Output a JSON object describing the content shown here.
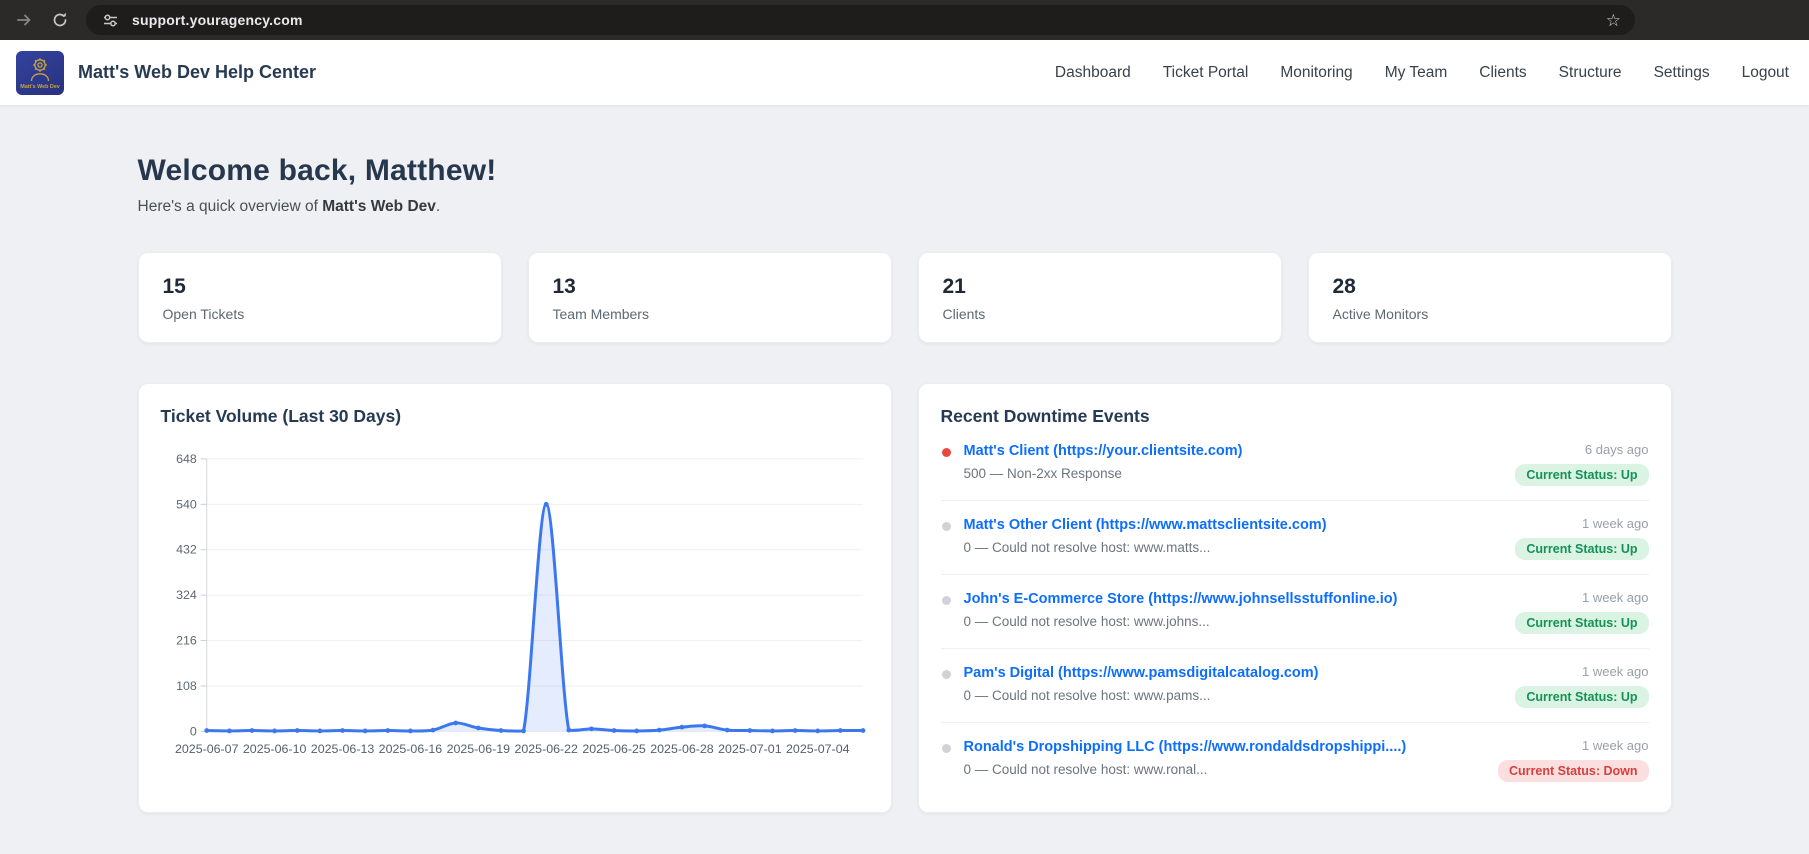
{
  "browser": {
    "url": "support.youragency.com"
  },
  "header": {
    "title": "Matt's Web Dev Help Center",
    "logo_text": "Matt's Web Dev",
    "nav": [
      "Dashboard",
      "Ticket Portal",
      "Monitoring",
      "My Team",
      "Clients",
      "Structure",
      "Settings",
      "Logout"
    ]
  },
  "welcome": {
    "heading": "Welcome back, Matthew!",
    "subtitle_prefix": "Here's a quick overview of ",
    "brand": "Matt's Web Dev",
    "subtitle_suffix": "."
  },
  "stats": [
    {
      "value": "15",
      "label": "Open Tickets"
    },
    {
      "value": "13",
      "label": "Team Members"
    },
    {
      "value": "21",
      "label": "Clients"
    },
    {
      "value": "28",
      "label": "Active Monitors"
    }
  ],
  "chart_data": {
    "type": "line",
    "title": "Ticket Volume (Last 30 Days)",
    "xlabel": "",
    "ylabel": "",
    "ylim": [
      0,
      648
    ],
    "yticks": [
      0,
      108,
      216,
      324,
      432,
      540,
      648
    ],
    "grid": "horizontal",
    "legend": "none",
    "tick_label_every": 3,
    "categories": [
      "2025-06-07",
      "2025-06-08",
      "2025-06-09",
      "2025-06-10",
      "2025-06-11",
      "2025-06-12",
      "2025-06-13",
      "2025-06-14",
      "2025-06-15",
      "2025-06-16",
      "2025-06-17",
      "2025-06-18",
      "2025-06-19",
      "2025-06-20",
      "2025-06-21",
      "2025-06-22",
      "2025-06-23",
      "2025-06-24",
      "2025-06-25",
      "2025-06-26",
      "2025-06-27",
      "2025-06-28",
      "2025-06-29",
      "2025-06-30",
      "2025-07-01",
      "2025-07-02",
      "2025-07-03",
      "2025-07-04",
      "2025-07-05",
      "2025-07-06"
    ],
    "values": [
      2,
      1,
      2,
      1,
      2,
      1,
      2,
      1,
      2,
      1,
      3,
      20,
      8,
      2,
      1,
      540,
      3,
      6,
      2,
      1,
      3,
      10,
      13,
      3,
      2,
      1,
      2,
      1,
      2,
      2
    ],
    "line_color": "#3b78ef",
    "fill_color": "rgba(61,122,240,0.14)"
  },
  "downtime": {
    "title": "Recent Downtime Events",
    "events": [
      {
        "name": "Matt's Client (https://your.clientsite.com)",
        "detail": "500 — Non-2xx Response",
        "time": "6 days ago",
        "status_label": "Current Status: Up",
        "status": "up",
        "dot": "red"
      },
      {
        "name": "Matt's Other Client (https://www.mattsclientsite.com)",
        "detail": "0 — Could not resolve host: www.matts...",
        "time": "1 week ago",
        "status_label": "Current Status: Up",
        "status": "up",
        "dot": "gray"
      },
      {
        "name": "John's E-Commerce Store (https://www.johnsellsstuffonline.io)",
        "detail": "0 — Could not resolve host: www.johns...",
        "time": "1 week ago",
        "status_label": "Current Status: Up",
        "status": "up",
        "dot": "gray"
      },
      {
        "name": "Pam's Digital (https://www.pamsdigitalcatalog.com)",
        "detail": "0 — Could not resolve host: www.pams...",
        "time": "1 week ago",
        "status_label": "Current Status: Up",
        "status": "up",
        "dot": "gray"
      },
      {
        "name": "Ronald's Dropshipping LLC (https://www.rondaldsdropshippi....)",
        "detail": "0 — Could not resolve host: www.ronal...",
        "time": "1 week ago",
        "status_label": "Current Status: Down",
        "status": "down",
        "dot": "gray"
      }
    ]
  },
  "colors": {
    "accent_blue": "#3b78ef",
    "link_blue": "#0d6efd",
    "status_up_bg": "#daf3e3",
    "status_up_text": "#149257",
    "status_down_bg": "#fbdede",
    "status_down_text": "#d64040",
    "alert_dot_red": "#e8483f",
    "page_bg": "#eef0f3",
    "browser_bar_bg": "#2b2a29",
    "url_pill_bg": "#1e1d1c"
  }
}
